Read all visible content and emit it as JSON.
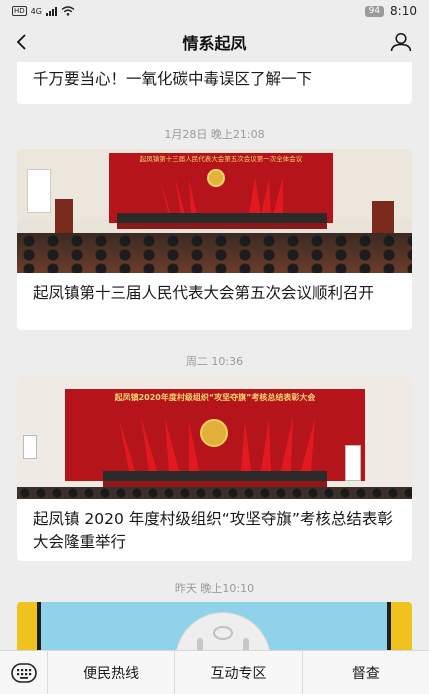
{
  "status_bar": {
    "hd": "HD",
    "network": "4G",
    "battery": "94",
    "time": "8:10"
  },
  "nav": {
    "title": "情系起凤",
    "back_icon": "chevron-left-icon",
    "user_icon": "person-icon"
  },
  "feed": {
    "items": [
      {
        "timestamp": "",
        "title": "千万要当心！一氧化碳中毒误区了解一下"
      },
      {
        "timestamp": "1月28日 晚上21:08",
        "banner": "起凤镇第十三届人民代表大会第五次会议第一次全体会议",
        "title": "起凤镇第十三届人民代表大会第五次会议顺利召开"
      },
      {
        "timestamp": "周二 10:36",
        "banner": "起凤镇2020年度村级组织“攻坚夺旗”考核总结表彰大会",
        "title": "起凤镇 2020 年度村级组织“攻坚夺旗”考核总结表彰大会隆重举行"
      },
      {
        "timestamp": "昨天 晚上10:10",
        "title": ""
      }
    ]
  },
  "menu": {
    "keyboard_icon": "keyboard-icon",
    "items": [
      {
        "label": "便民热线"
      },
      {
        "label": "互动专区"
      },
      {
        "label": "督查"
      }
    ]
  },
  "colors": {
    "background": "#ededed",
    "card": "#ffffff",
    "stage_red": "#b4141a",
    "flag_red": "#d6161c",
    "banner_gold": "#f4d873"
  }
}
